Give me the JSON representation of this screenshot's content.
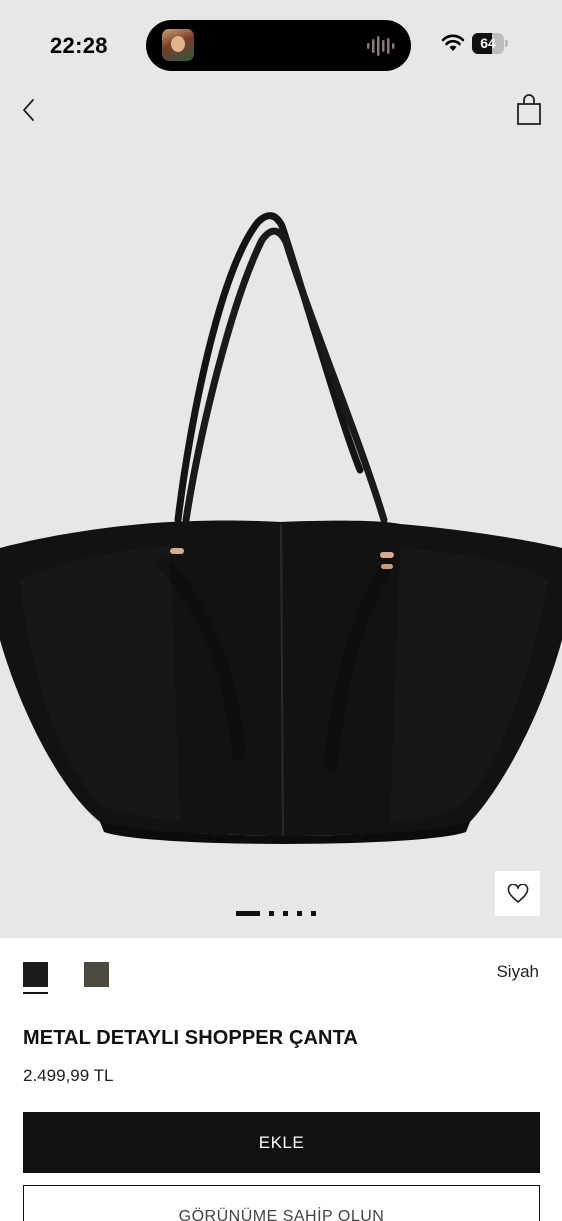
{
  "status_bar": {
    "time": "22:28",
    "battery": "64",
    "battery_level": 0.64
  },
  "nav": {
    "back_icon": "chevron-left-icon",
    "bag_icon": "shopping-bag-icon"
  },
  "gallery": {
    "total_images": 5,
    "active_index": 0,
    "wishlist_icon": "heart-icon"
  },
  "colors": {
    "selected_name": "Siyah",
    "swatches": [
      {
        "hex": "#1b1c1e",
        "selected": true
      },
      {
        "hex": "#4d4840",
        "selected": false
      }
    ]
  },
  "product": {
    "title": "METAL DETAYLI SHOPPER ÇANTA",
    "price": "2.499,99 TL"
  },
  "actions": {
    "add_label": "EKLE",
    "secondary_label": "GÖRÜNÜME SAHİP OLUN"
  }
}
